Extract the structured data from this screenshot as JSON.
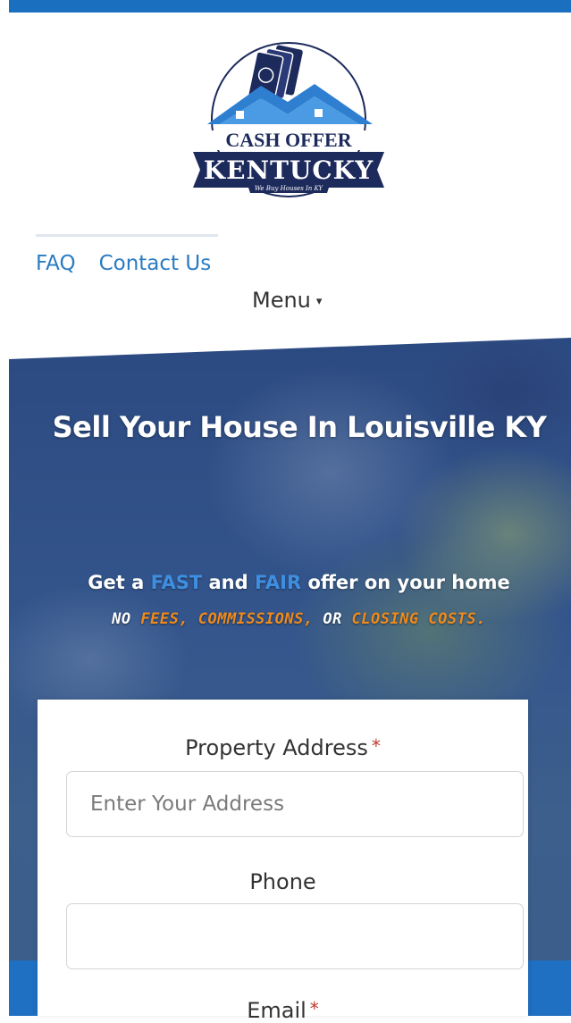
{
  "logo": {
    "line1": "CASH OFFER",
    "line2": "KENTUCKY",
    "tagline": "We Buy Houses In KY"
  },
  "nav": {
    "links": [
      "FAQ",
      "Contact Us"
    ],
    "menu_label": "Menu",
    "menu_caret": "▾"
  },
  "hero": {
    "title": "Sell Your House In Louisville KY",
    "subtitle": {
      "pre": "Get a ",
      "fast": "FAST",
      "and": " and ",
      "fair": "FAIR",
      "post": " offer on your home"
    },
    "subtitle2": {
      "no": "NO ",
      "fees": "FEES, COMMISSIONS,",
      "or": " OR ",
      "closing": "CLOSING COSTS."
    }
  },
  "form": {
    "address_label": "Property Address",
    "address_required": "*",
    "address_placeholder": "Enter Your Address",
    "address_value": "",
    "phone_label": "Phone",
    "phone_value": "",
    "email_label": "Email",
    "email_required": "*"
  },
  "colors": {
    "brand_blue": "#1a70bf",
    "link_blue": "#2a7bc2",
    "accent_orange": "#f08a1c",
    "required_red": "#c0392b"
  }
}
